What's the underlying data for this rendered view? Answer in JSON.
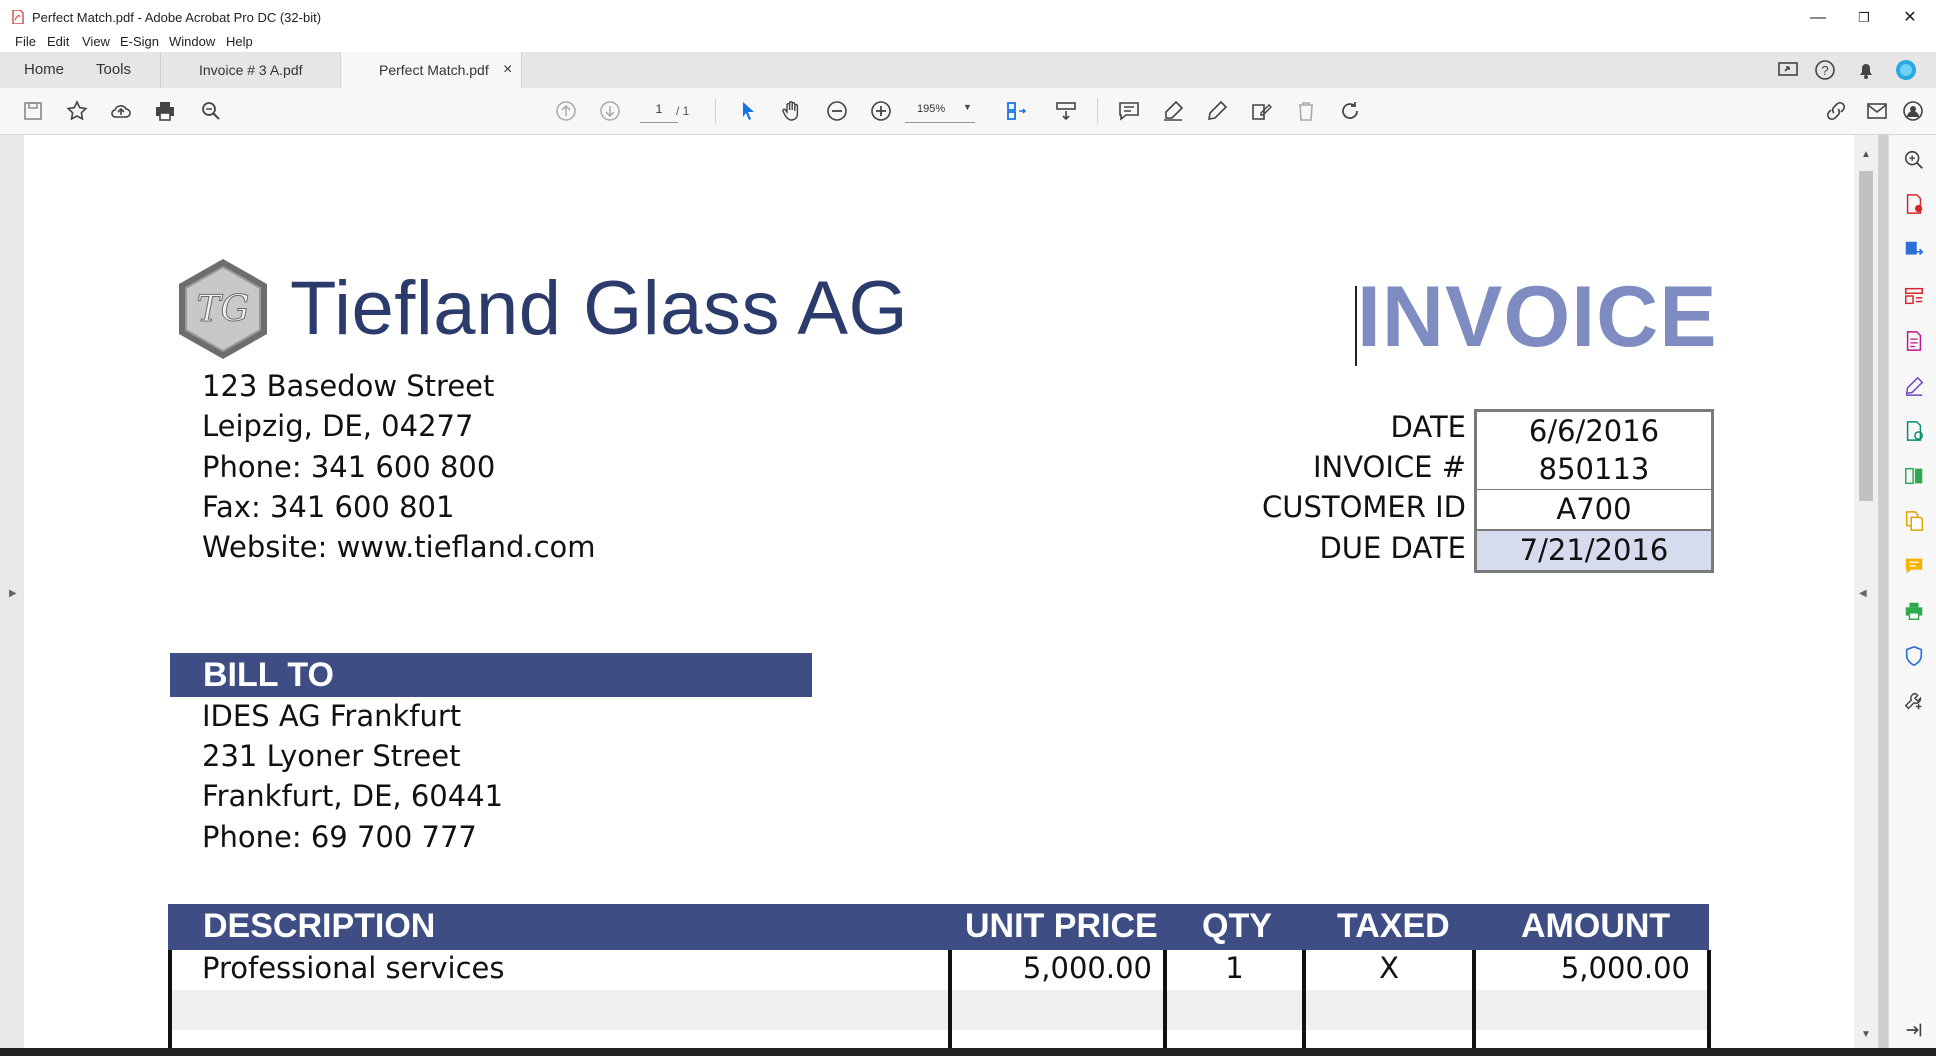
{
  "window": {
    "title": "Perfect Match.pdf - Adobe Acrobat Pro DC (32-bit)",
    "minimize": "—",
    "maximize": "❐",
    "close": "✕"
  },
  "menu": [
    "File",
    "Edit",
    "View",
    "E-Sign",
    "Window",
    "Help"
  ],
  "tabs": {
    "home": "Home",
    "tools": "Tools",
    "doc1": "Invoice # 3 A.pdf",
    "doc2": "Perfect Match.pdf",
    "close": "×"
  },
  "toolbar": {
    "page_current": "1",
    "page_total": "/ 1",
    "zoom": "195%"
  },
  "invoice": {
    "company_name": "Tiefland Glass AG",
    "logo_text": "TG",
    "title": "INVOICE",
    "address": [
      "123 Basedow Street",
      "Leipzig, DE, 04277",
      "Phone: 341 600 800",
      "Fax: 341 600 801",
      "Website: www.tiefland.com"
    ],
    "fields": [
      {
        "label": "DATE",
        "value": "6/6/2016"
      },
      {
        "label": "INVOICE #",
        "value": "850113"
      },
      {
        "label": "CUSTOMER ID",
        "value": "A700"
      },
      {
        "label": "DUE DATE",
        "value": "7/21/2016"
      }
    ],
    "bill_to_label": "BILL TO",
    "bill_to": [
      "IDES AG Frankfurt",
      "231 Lyoner Street",
      "Frankfurt, DE, 60441",
      "Phone: 69 700 777"
    ],
    "columns": [
      "DESCRIPTION",
      "UNIT PRICE",
      "QTY",
      "TAXED",
      "AMOUNT"
    ],
    "rows": [
      {
        "description": "Professional services",
        "unit_price": "5,000.00",
        "qty": "1",
        "taxed": "X",
        "amount": "5,000.00"
      }
    ]
  },
  "colors": {
    "header_band": "#3e4e85",
    "company": "#2b3c6c",
    "invoice_title": "#7f8cc2",
    "due_highlight": "#d6dcee",
    "acrobat_red": "#d7262c",
    "acrobat_blue": "#1473e6"
  }
}
